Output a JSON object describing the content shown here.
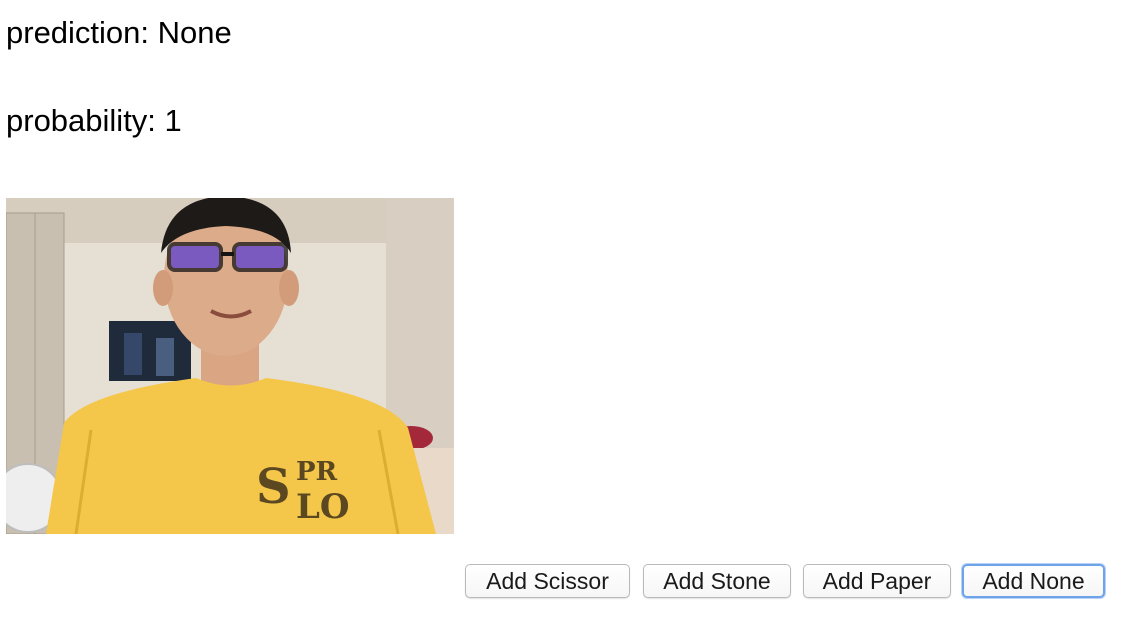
{
  "prediction": {
    "label": "prediction:",
    "value": "None"
  },
  "probability": {
    "label": "probability:",
    "value": "1"
  },
  "webcam": {
    "shirt_color": "#f4c64a",
    "wall_color": "#e6dfd3"
  },
  "buttons": [
    {
      "label": "Add Scissor"
    },
    {
      "label": "Add Stone"
    },
    {
      "label": "Add Paper"
    },
    {
      "label": "Add None",
      "focused": true
    }
  ]
}
